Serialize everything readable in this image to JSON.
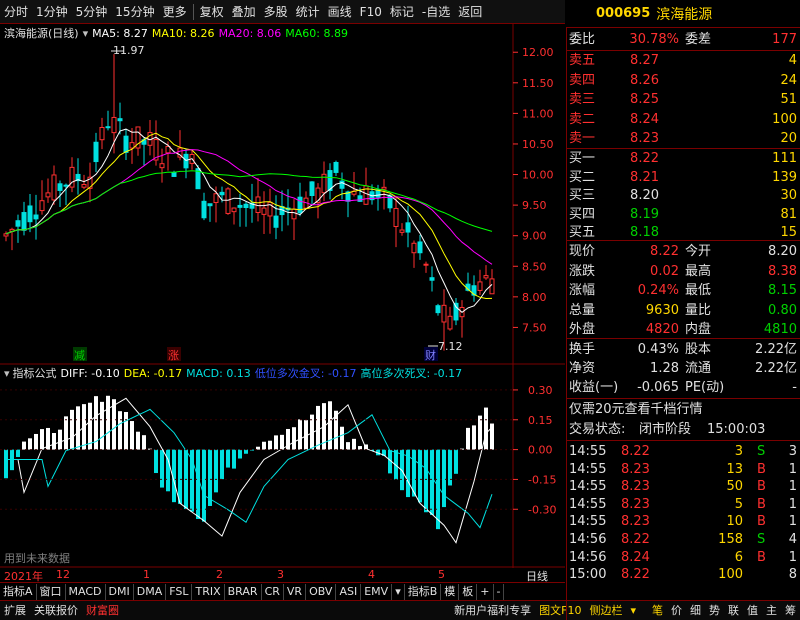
{
  "toolbar": {
    "items": [
      "分时",
      "1分钟",
      "5分钟",
      "15分钟",
      "更多",
      "复权",
      "叠加",
      "多股",
      "统计",
      "画线",
      "F10",
      "标记",
      "-自选",
      "返回"
    ]
  },
  "stock": {
    "code": "000695",
    "name": "滨海能源"
  },
  "main_chart": {
    "title": "滨海能源(日线)",
    "ma5": "MA5: 8.27",
    "ma10": "MA10: 8.26",
    "ma20": "MA20: 8.06",
    "ma60": "MA60: 8.89",
    "high_label": "11.97",
    "low_label": "7.12",
    "marker_jian": "减",
    "marker_zhang": "涨",
    "marker_cai": "财",
    "y_ticks": [
      "12.00",
      "11.50",
      "11.00",
      "10.50",
      "10.00",
      "9.50",
      "9.00",
      "8.50",
      "8.00",
      "7.50"
    ]
  },
  "indicator": {
    "title": "指标公式",
    "diff": "DIFF: -0.10",
    "dea": "DEA: -0.17",
    "macd": "MACD: 0.13",
    "low_cross": "低位多次金叉: -0.17",
    "high_cross": "高位多次死叉: -0.17",
    "y_ticks": [
      "0.30",
      "0.15",
      "0.00",
      "-0.15",
      "-0.30"
    ],
    "footer": "用到未来数据"
  },
  "date_axis": {
    "year": "2021年",
    "months": [
      "12",
      "1",
      "2",
      "3",
      "4",
      "5"
    ],
    "right_label": "日线"
  },
  "indicator_tabs": [
    "指标A",
    "窗口",
    "MACD",
    "DMI",
    "DMA",
    "FSL",
    "TRIX",
    "BRAR",
    "CR",
    "VR",
    "OBV",
    "ASI",
    "EMV",
    "指标B",
    "模",
    "板",
    "+",
    "-"
  ],
  "bottom_bar": {
    "items": [
      "扩展",
      "关联报价",
      "财富圈"
    ],
    "right": [
      "新用户福利专享",
      "图文F10",
      "侧边栏"
    ],
    "panel_tabs": [
      "笔",
      "价",
      "细",
      "势",
      "联",
      "值",
      "主",
      "筹"
    ]
  },
  "quote": {
    "weibi_label": "委比",
    "weibi": "30.78%",
    "weicha_label": "委差",
    "weicha": "177",
    "sell": [
      {
        "label": "卖五",
        "price": "8.27",
        "vol": "4"
      },
      {
        "label": "卖四",
        "price": "8.26",
        "vol": "24"
      },
      {
        "label": "卖三",
        "price": "8.25",
        "vol": "51"
      },
      {
        "label": "卖二",
        "price": "8.24",
        "vol": "100"
      },
      {
        "label": "卖一",
        "price": "8.23",
        "vol": "20"
      }
    ],
    "buy": [
      {
        "label": "买一",
        "price": "8.22",
        "vol": "111"
      },
      {
        "label": "买二",
        "price": "8.21",
        "vol": "139"
      },
      {
        "label": "买三",
        "price": "8.20",
        "vol": "30"
      },
      {
        "label": "买四",
        "price": "8.19",
        "vol": "81"
      },
      {
        "label": "买五",
        "price": "8.18",
        "vol": "15"
      }
    ],
    "stats": [
      {
        "l1": "现价",
        "v1": "8.22",
        "l2": "今开",
        "v2": "8.20"
      },
      {
        "l1": "涨跌",
        "v1": "0.02",
        "l2": "最高",
        "v2": "8.38"
      },
      {
        "l1": "涨幅",
        "v1": "0.24%",
        "l2": "最低",
        "v2": "8.15"
      },
      {
        "l1": "总量",
        "v1": "9630",
        "l2": "量比",
        "v2": "0.80"
      },
      {
        "l1": "外盘",
        "v1": "4820",
        "l2": "内盘",
        "v2": "4810"
      }
    ],
    "stats2": [
      {
        "l1": "换手",
        "v1": "0.43%",
        "l2": "股本",
        "v2": "2.22亿"
      },
      {
        "l1": "净资",
        "v1": "1.28",
        "l2": "流通",
        "v2": "2.22亿"
      },
      {
        "l1": "收益(一)",
        "v1": "-0.065",
        "l2": "PE(动)",
        "v2": "-"
      }
    ],
    "promo": "仅需20元查看千档行情",
    "trade_state_label": "交易状态:",
    "trade_state": "闭市阶段",
    "trade_time": "15:00:03",
    "ticks": [
      {
        "time": "14:55",
        "price": "8.22",
        "vol": "3",
        "side": "S",
        "n": "3"
      },
      {
        "time": "14:55",
        "price": "8.23",
        "vol": "13",
        "side": "B",
        "n": "1"
      },
      {
        "time": "14:55",
        "price": "8.23",
        "vol": "50",
        "side": "B",
        "n": "1"
      },
      {
        "time": "14:55",
        "price": "8.23",
        "vol": "5",
        "side": "B",
        "n": "1"
      },
      {
        "time": "14:55",
        "price": "8.23",
        "vol": "10",
        "side": "B",
        "n": "1"
      },
      {
        "time": "14:56",
        "price": "8.22",
        "vol": "158",
        "side": "S",
        "n": "4"
      },
      {
        "time": "14:56",
        "price": "8.24",
        "vol": "6",
        "side": "B",
        "n": "1"
      },
      {
        "time": "15:00",
        "price": "8.22",
        "vol": "100",
        "side": "",
        "n": "8"
      }
    ]
  },
  "colors": {
    "up": "#ff3030",
    "down": "#00e0e0",
    "ma5": "#ffffff",
    "ma10": "#ffff00",
    "ma20": "#ff00ff",
    "ma60": "#00ff00"
  }
}
